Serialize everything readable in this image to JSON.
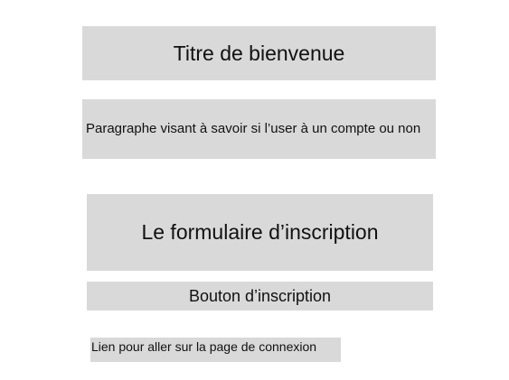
{
  "welcome_title": "Titre de bienvenue",
  "account_paragraph": "Paragraphe visant à savoir si l’user à un compte ou non",
  "signup_form": "Le formulaire d’inscription",
  "signup_button": "Bouton d’inscription",
  "login_link": "Lien pour aller sur la page de connexion",
  "colors": {
    "block_background": "#d9d9d9",
    "page_background": "#ffffff",
    "text": "#111111"
  }
}
